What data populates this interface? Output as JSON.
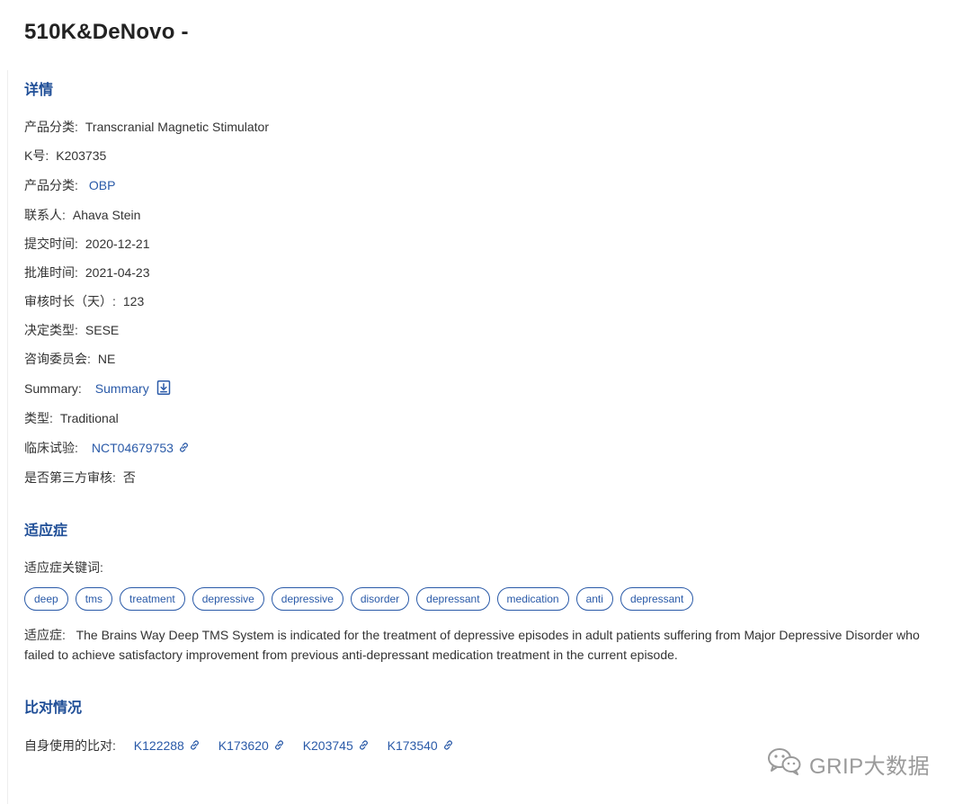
{
  "title": "510K&DeNovo -",
  "sections": {
    "details": "详情",
    "indication": "适应症",
    "comparison": "比对情况"
  },
  "details": {
    "product_class_name": {
      "label": "产品分类:",
      "value": "Transcranial Magnetic Stimulator"
    },
    "k_number": {
      "label": "K号:",
      "value": "K203735"
    },
    "product_code": {
      "label": "产品分类:",
      "value": "OBP"
    },
    "contact": {
      "label": "联系人:",
      "value": "Ahava Stein"
    },
    "submitted": {
      "label": "提交时间:",
      "value": "2020-12-21"
    },
    "approved": {
      "label": "批准时间:",
      "value": "2021-04-23"
    },
    "review_days": {
      "label": "审核时长（天）:",
      "value": "123"
    },
    "decision": {
      "label": "决定类型:",
      "value": "SESE"
    },
    "committee": {
      "label": "咨询委员会:",
      "value": "NE"
    },
    "summary": {
      "label": "Summary:",
      "value": "Summary",
      "icon": "download-file-icon"
    },
    "type": {
      "label": "类型:",
      "value": "Traditional"
    },
    "clinical_trial": {
      "label": "临床试验:",
      "value": "NCT04679753",
      "icon": "link-icon"
    },
    "third_party": {
      "label": "是否第三方审核:",
      "value": "否"
    }
  },
  "indication": {
    "keywords_label": "适应症关键词:",
    "keywords": [
      "deep",
      "tms",
      "treatment",
      "depressive",
      "depressive",
      "disorder",
      "depressant",
      "medication",
      "anti",
      "depressant"
    ],
    "text_label": "适应症:",
    "text": "The Brains Way Deep TMS System is indicated for the treatment of depressive episodes in adult patients suffering from Major Depressive Disorder who failed to achieve satisfactory improvement from previous anti-depressant medication treatment in the current episode."
  },
  "comparison": {
    "label": "自身使用的比对:",
    "items": [
      "K122288",
      "K173620",
      "K203745",
      "K173540"
    ]
  },
  "watermark": "GRIP大数据",
  "colors": {
    "accent": "#2a5aa8",
    "section_title": "#1f4e97"
  }
}
